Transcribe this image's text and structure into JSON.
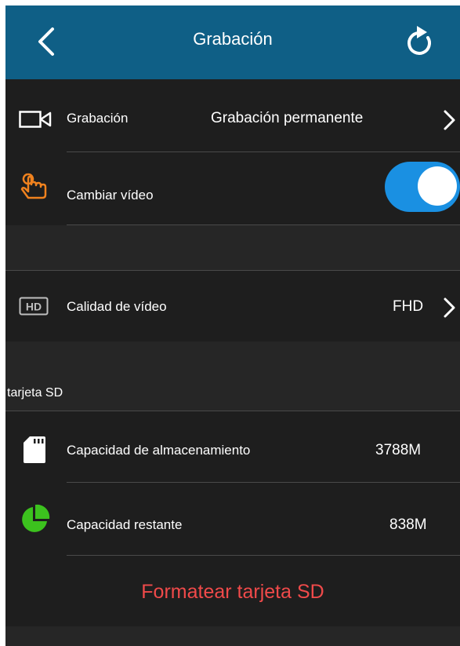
{
  "header": {
    "title": "Grabación"
  },
  "recording": {
    "label": "Grabación",
    "value": "Grabación permanente"
  },
  "switch_video": {
    "label": "Cambiar vídeo",
    "enabled": true
  },
  "video_quality": {
    "label": "Calidad de vídeo",
    "value": "FHD"
  },
  "sd_card": {
    "section_title": "tarjeta SD",
    "storage_capacity": {
      "label": "Capacidad de almacenamiento",
      "value": "3788M"
    },
    "remaining_capacity": {
      "label": "Capacidad restante",
      "value": "838M"
    },
    "format_label": "Formatear tarjeta SD"
  },
  "colors": {
    "header_bg": "#0f5f86",
    "toggle_on": "#1a90e2",
    "hand_icon": "#f0821e",
    "pie_icon": "#3cc21e",
    "format_text": "#f04a4a"
  }
}
